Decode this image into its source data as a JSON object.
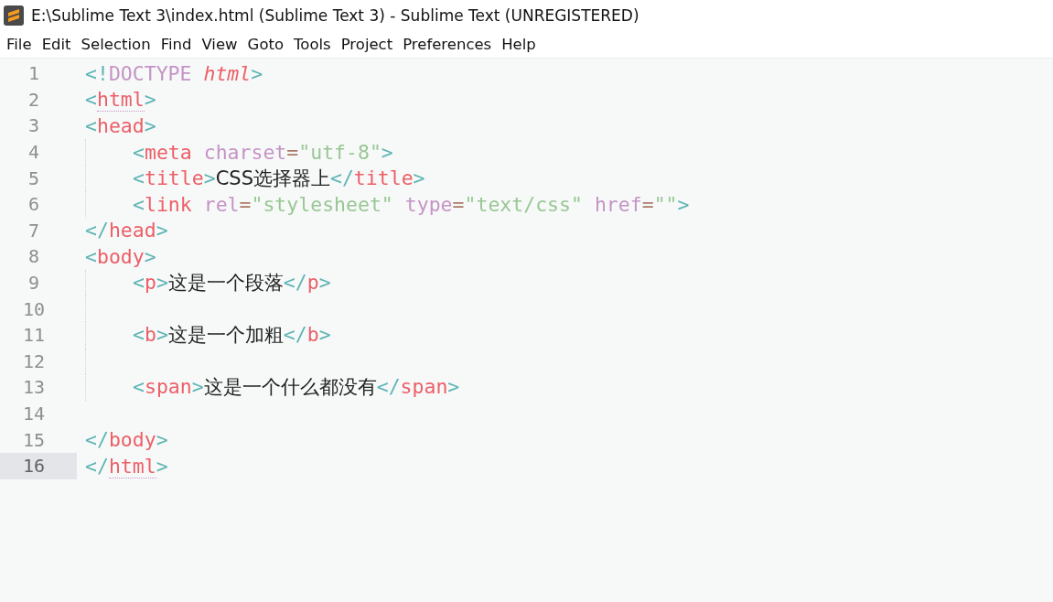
{
  "window": {
    "title": "E:\\Sublime Text 3\\index.html (Sublime Text 3) - Sublime Text (UNREGISTERED)"
  },
  "menu": [
    "File",
    "Edit",
    "Selection",
    "Find",
    "View",
    "Goto",
    "Tools",
    "Project",
    "Preferences",
    "Help"
  ],
  "lines": [
    {
      "number": "1",
      "selected": false,
      "indented": false,
      "tokens": [
        {
          "kind": "punct",
          "text": "<!"
        },
        {
          "kind": "doctype",
          "text": "DOCTYPE "
        },
        {
          "kind": "doctype-name",
          "text": "html"
        },
        {
          "kind": "punct",
          "text": ">"
        }
      ]
    },
    {
      "number": "2",
      "selected": false,
      "indented": false,
      "tokens": [
        {
          "kind": "punct",
          "text": "<"
        },
        {
          "kind": "tag",
          "text": "html",
          "matched": true
        },
        {
          "kind": "punct",
          "text": ">"
        }
      ]
    },
    {
      "number": "3",
      "selected": false,
      "indented": false,
      "tokens": [
        {
          "kind": "punct",
          "text": "<"
        },
        {
          "kind": "tag",
          "text": "head"
        },
        {
          "kind": "punct",
          "text": ">"
        }
      ]
    },
    {
      "number": "4",
      "selected": false,
      "indented": true,
      "tokens": [
        {
          "kind": "punct",
          "text": "<"
        },
        {
          "kind": "tag",
          "text": "meta "
        },
        {
          "kind": "attr",
          "text": "charset"
        },
        {
          "kind": "eq",
          "text": "="
        },
        {
          "kind": "string",
          "text": "\"utf-8\""
        },
        {
          "kind": "punct",
          "text": ">"
        }
      ]
    },
    {
      "number": "5",
      "selected": false,
      "indented": true,
      "tokens": [
        {
          "kind": "punct",
          "text": "<"
        },
        {
          "kind": "tag",
          "text": "title"
        },
        {
          "kind": "punct",
          "text": ">"
        },
        {
          "kind": "text",
          "text": "CSS选择器上"
        },
        {
          "kind": "punct",
          "text": "</"
        },
        {
          "kind": "tag",
          "text": "title"
        },
        {
          "kind": "punct",
          "text": ">"
        }
      ]
    },
    {
      "number": "6",
      "selected": false,
      "indented": true,
      "tokens": [
        {
          "kind": "punct",
          "text": "<"
        },
        {
          "kind": "tag",
          "text": "link "
        },
        {
          "kind": "attr",
          "text": "rel"
        },
        {
          "kind": "eq",
          "text": "="
        },
        {
          "kind": "string",
          "text": "\"stylesheet\" "
        },
        {
          "kind": "attr",
          "text": "type"
        },
        {
          "kind": "eq",
          "text": "="
        },
        {
          "kind": "string",
          "text": "\"text/css\" "
        },
        {
          "kind": "attr",
          "text": "href"
        },
        {
          "kind": "eq",
          "text": "="
        },
        {
          "kind": "string",
          "text": "\"\""
        },
        {
          "kind": "punct",
          "text": ">"
        }
      ]
    },
    {
      "number": "7",
      "selected": false,
      "indented": false,
      "tokens": [
        {
          "kind": "punct",
          "text": "</"
        },
        {
          "kind": "tag",
          "text": "head"
        },
        {
          "kind": "punct",
          "text": ">"
        }
      ]
    },
    {
      "number": "8",
      "selected": false,
      "indented": false,
      "tokens": [
        {
          "kind": "punct",
          "text": "<"
        },
        {
          "kind": "tag",
          "text": "body"
        },
        {
          "kind": "punct",
          "text": ">"
        }
      ]
    },
    {
      "number": "9",
      "selected": false,
      "indented": true,
      "tokens": [
        {
          "kind": "punct",
          "text": "<"
        },
        {
          "kind": "tag",
          "text": "p"
        },
        {
          "kind": "punct",
          "text": ">"
        },
        {
          "kind": "text",
          "text": "这是一个段落"
        },
        {
          "kind": "punct",
          "text": "</"
        },
        {
          "kind": "tag",
          "text": "p"
        },
        {
          "kind": "punct",
          "text": ">"
        }
      ]
    },
    {
      "number": "10",
      "selected": false,
      "indented": true
    },
    {
      "number": "11",
      "selected": false,
      "indented": true,
      "tokens": [
        {
          "kind": "punct",
          "text": "<"
        },
        {
          "kind": "tag",
          "text": "b"
        },
        {
          "kind": "punct",
          "text": ">"
        },
        {
          "kind": "text",
          "text": "这是一个加粗"
        },
        {
          "kind": "punct",
          "text": "</"
        },
        {
          "kind": "tag",
          "text": "b"
        },
        {
          "kind": "punct",
          "text": ">"
        }
      ]
    },
    {
      "number": "12",
      "selected": false,
      "indented": true
    },
    {
      "number": "13",
      "selected": false,
      "indented": true,
      "tokens": [
        {
          "kind": "punct",
          "text": "<"
        },
        {
          "kind": "tag",
          "text": "span"
        },
        {
          "kind": "punct",
          "text": ">"
        },
        {
          "kind": "text",
          "text": "这是一个什么都没有"
        },
        {
          "kind": "punct",
          "text": "</"
        },
        {
          "kind": "tag",
          "text": "span"
        },
        {
          "kind": "punct",
          "text": ">"
        }
      ]
    },
    {
      "number": "14",
      "selected": false,
      "indented": false
    },
    {
      "number": "15",
      "selected": false,
      "indented": false,
      "tokens": [
        {
          "kind": "punct",
          "text": "</"
        },
        {
          "kind": "tag",
          "text": "body"
        },
        {
          "kind": "punct",
          "text": ">"
        }
      ]
    },
    {
      "number": "16",
      "selected": true,
      "indented": false,
      "tokens": [
        {
          "kind": "punct",
          "text": "</"
        },
        {
          "kind": "tag",
          "text": "html",
          "matched": true
        },
        {
          "kind": "punct",
          "text": ">"
        }
      ]
    }
  ]
}
